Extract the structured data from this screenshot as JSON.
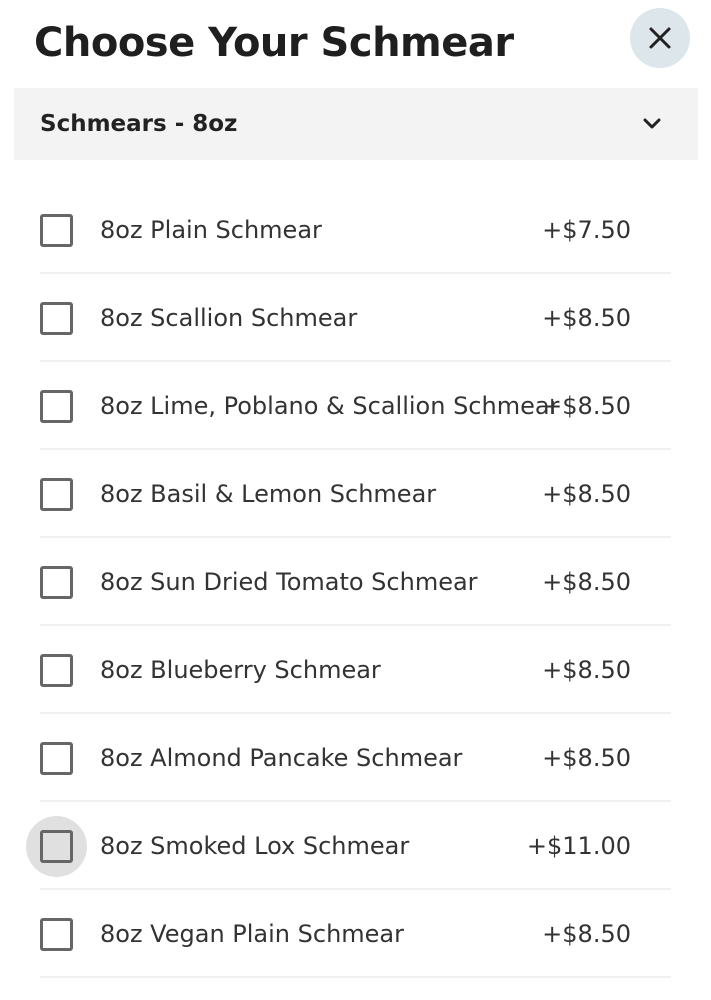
{
  "header": {
    "title": "Choose Your Schmear",
    "close_icon": "close-icon"
  },
  "section": {
    "label": "Schmears - 8oz",
    "expand_icon": "chevron-down-icon"
  },
  "options": [
    {
      "label": "8oz Plain Schmear",
      "price": "+$7.50",
      "checked": false
    },
    {
      "label": "8oz Scallion Schmear",
      "price": "+$8.50",
      "checked": false
    },
    {
      "label": "8oz Lime, Poblano & Scallion Schmear",
      "price": "+$8.50",
      "checked": false
    },
    {
      "label": "8oz Basil & Lemon Schmear",
      "price": "+$8.50",
      "checked": false
    },
    {
      "label": "8oz Sun Dried Tomato Schmear",
      "price": "+$8.50",
      "checked": false
    },
    {
      "label": "8oz Blueberry Schmear",
      "price": "+$8.50",
      "checked": false
    },
    {
      "label": "8oz Almond Pancake Schmear",
      "price": "+$8.50",
      "checked": false
    },
    {
      "label": "8oz Smoked Lox Schmear",
      "price": "+$11.00",
      "checked": false,
      "pressed": true
    },
    {
      "label": "8oz Vegan Plain Schmear",
      "price": "+$8.50",
      "checked": false
    }
  ],
  "colors": {
    "close_button_bg": "#dde6ea",
    "section_bg": "#f3f3f3",
    "checkbox_border": "#666666"
  }
}
